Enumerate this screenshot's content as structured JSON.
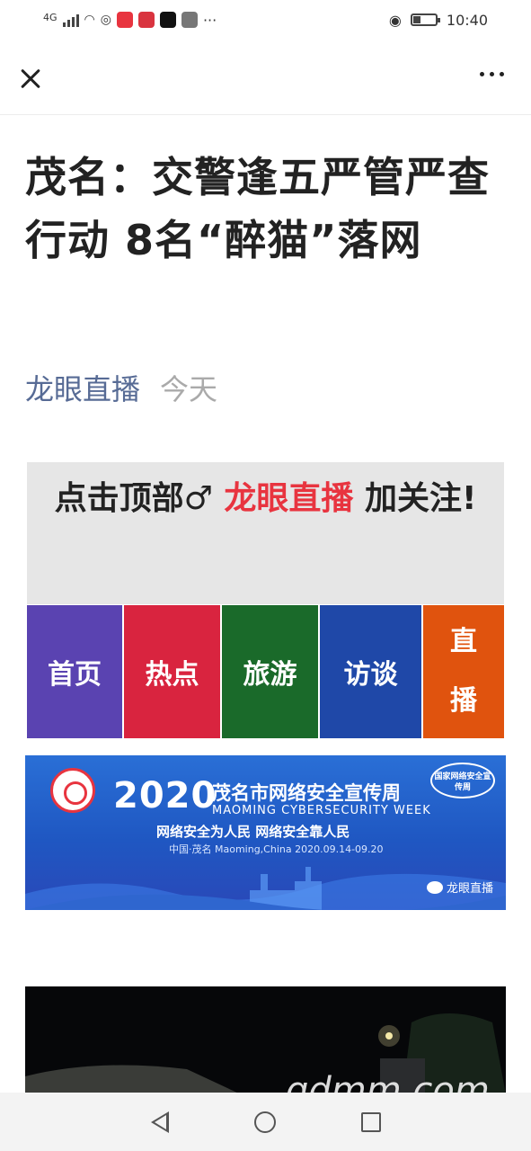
{
  "status_bar": {
    "network": "4G",
    "time": "10:40",
    "colors": {
      "app1": "#e8343f",
      "app2": "#d9343f",
      "app3": "#111111",
      "app4": "#666666"
    }
  },
  "nav": {
    "close_icon": "close-icon",
    "more_icon": "more-icon"
  },
  "article": {
    "title": "茂名：交警逢五严管严查行动 8名“醉猫”落网",
    "author": "龙眼直播",
    "date": "今天"
  },
  "follow_banner": {
    "prefix": "点击顶部♂",
    "highlight": "龙眼直播",
    "suffix": "加关注!",
    "highlight_color": "#e8343f"
  },
  "tiles": [
    {
      "label": "首页",
      "color": "#5a43b1"
    },
    {
      "label": "热点",
      "color": "#d9243f"
    },
    {
      "label": "旅游",
      "color": "#1a6a2a"
    },
    {
      "label": "访谈",
      "color": "#1f48a8"
    },
    {
      "label": "直播",
      "color": "#e0530e"
    }
  ],
  "cyber_banner": {
    "year": "2020",
    "cn_title": "茂名市网络安全宣传周",
    "en_title": "MAOMING CYBERSECURITY WEEK",
    "slogan": "网络安全为人民  网络安全靠人民",
    "location": "中国·茂名  Maoming,China  2020.09.14-09.20",
    "badge": "国家网络安全宣传周",
    "watermark": "龙眼直播"
  },
  "site_watermark": "gdmm.com"
}
